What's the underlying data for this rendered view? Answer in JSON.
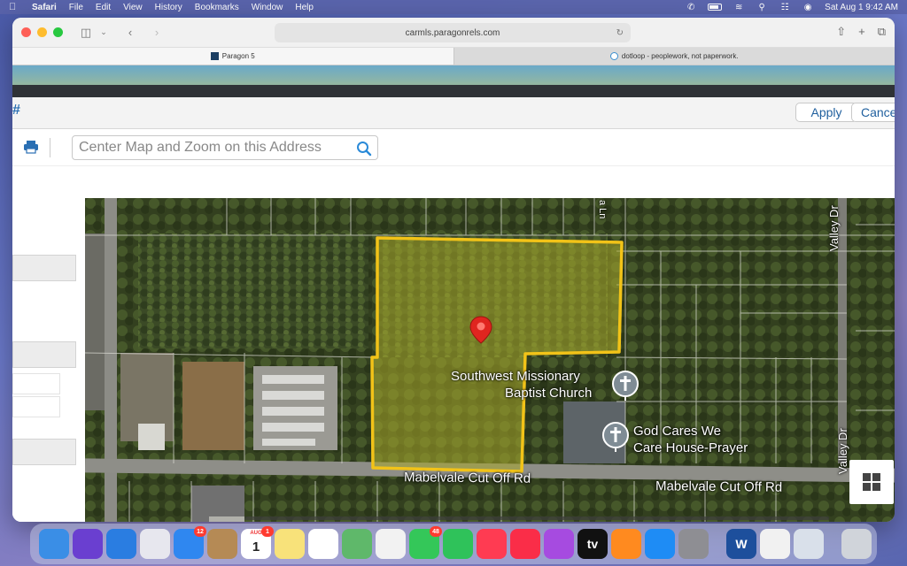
{
  "menubar": {
    "items": [
      "Safari",
      "File",
      "Edit",
      "View",
      "History",
      "Bookmarks",
      "Window",
      "Help"
    ],
    "clock": "Sat Aug 1  9:42 AM"
  },
  "browser": {
    "url": "carmls.paragonrels.com",
    "tabs": [
      {
        "label": "Paragon 5",
        "active": true
      },
      {
        "label": "dotloop - peoplework, not paperwork.",
        "active": false
      }
    ]
  },
  "page": {
    "hash_symbol": "#",
    "apply_label": "Apply",
    "cancel_label": "Cancel",
    "address_placeholder": "Center Map and Zoom on this Address"
  },
  "map": {
    "labels": {
      "church1_line1": "Southwest Missionary",
      "church1_line2": "Baptist Church",
      "church2_line1": "God Cares We",
      "church2_line2": "Care House-Prayer",
      "road_main_left": "Mabelvale Cut Off Rd",
      "road_main_right": "Mabelvale Cut Off Rd",
      "road_valley_top": "Valley Dr",
      "road_valley_bottom": "Valley Dr",
      "road_top_fragment": "a Ln"
    },
    "colors": {
      "parcel_outline": "#f2c318",
      "pin": "#e0251f"
    }
  },
  "dock": {
    "apps": [
      {
        "name": "Finder",
        "color": "#3a8ee6"
      },
      {
        "name": "Siri",
        "color": "#6a3fd0"
      },
      {
        "name": "Safari",
        "color": "#2a7de1"
      },
      {
        "name": "Launchpad",
        "color": "#e7e7ee"
      },
      {
        "name": "Mail",
        "color": "#2f87f0",
        "badge": "12"
      },
      {
        "name": "Contacts",
        "color": "#b58a55"
      },
      {
        "name": "Calendar",
        "color": "#ffffff",
        "badge": "1",
        "text_top": "AUG",
        "text_main": "1"
      },
      {
        "name": "Notes",
        "color": "#f8e27a"
      },
      {
        "name": "Reminders",
        "color": "#ffffff"
      },
      {
        "name": "Maps",
        "color": "#5fb86a"
      },
      {
        "name": "Photos",
        "color": "#f2f2f2"
      },
      {
        "name": "Messages",
        "color": "#34c759",
        "badge": "48"
      },
      {
        "name": "FaceTime",
        "color": "#2fc25a"
      },
      {
        "name": "News",
        "color": "#ff3b52"
      },
      {
        "name": "Music",
        "color": "#fa2d48"
      },
      {
        "name": "Podcasts",
        "color": "#a64be0"
      },
      {
        "name": "TV",
        "color": "#111111",
        "text_main": "tv"
      },
      {
        "name": "Books",
        "color": "#ff8a1f"
      },
      {
        "name": "App Store",
        "color": "#1e8cf5"
      },
      {
        "name": "System Preferences",
        "color": "#8e8e93"
      },
      {
        "name": "Word",
        "color": "#1d4f9c",
        "text_main": "W"
      },
      {
        "name": "TextEdit",
        "color": "#f1f1f1"
      },
      {
        "name": "Preview",
        "color": "#d9e0ea"
      },
      {
        "name": "Trash",
        "color": "#d0d4da"
      }
    ]
  }
}
